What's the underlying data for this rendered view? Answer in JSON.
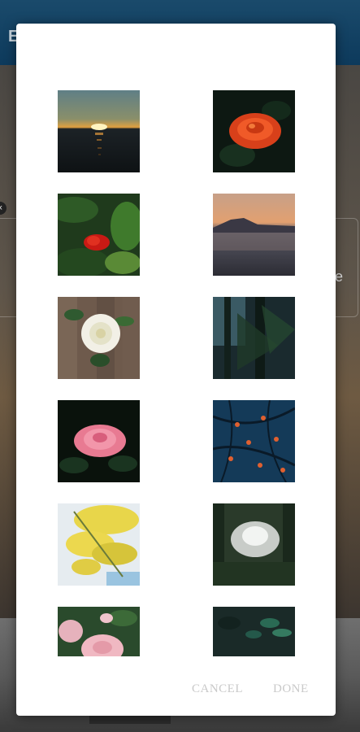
{
  "background": {
    "title_partial": "E",
    "edge_text": "e",
    "close_glyph": "×"
  },
  "dialog": {
    "images": [
      {
        "subject": "sunset over sea"
      },
      {
        "subject": "orange rose"
      },
      {
        "subject": "red flower in foliage"
      },
      {
        "subject": "lake with mountain at dusk"
      },
      {
        "subject": "white rose on wood"
      },
      {
        "subject": "dark forest"
      },
      {
        "subject": "pink rose"
      },
      {
        "subject": "blue berries branches"
      },
      {
        "subject": "yellow mimosa"
      },
      {
        "subject": "misty forest light"
      },
      {
        "subject": "pink roses bouquet"
      },
      {
        "subject": "dark green leaves"
      }
    ],
    "actions": {
      "cancel_label": "CANCEL",
      "done_label": "DONE"
    }
  }
}
